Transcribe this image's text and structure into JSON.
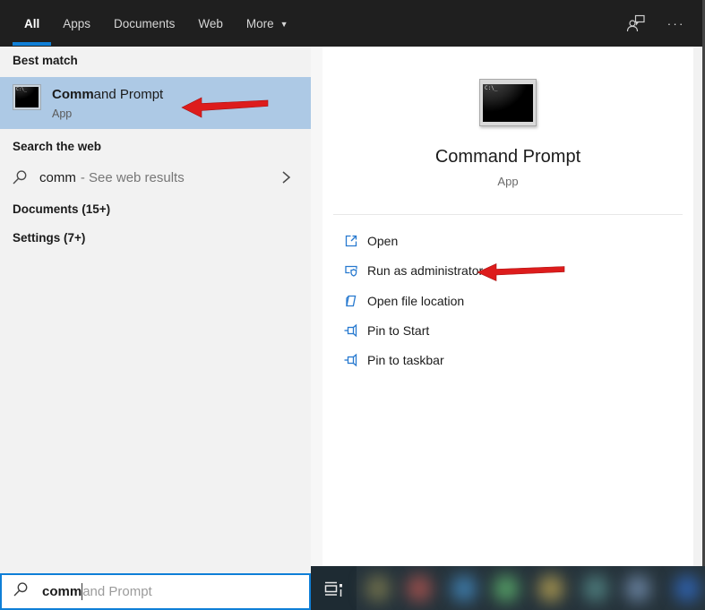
{
  "header": {
    "tabs": [
      {
        "label": "All",
        "active": true
      },
      {
        "label": "Apps",
        "active": false
      },
      {
        "label": "Documents",
        "active": false
      },
      {
        "label": "Web",
        "active": false
      },
      {
        "label": "More",
        "active": false,
        "dropdown": true
      }
    ],
    "feedback_icon": "user-feedback",
    "options_icon": "more-options"
  },
  "left_panel": {
    "best_match_label": "Best match",
    "best_match": {
      "title_bold": "Comm",
      "title_rest": "and Prompt",
      "subtitle": "App"
    },
    "search_web_label": "Search the web",
    "web_row": {
      "query": "comm",
      "suffix": "- See web results"
    },
    "documents_label": "Documents (15+)",
    "settings_label": "Settings (7+)"
  },
  "right_panel": {
    "app_name": "Command Prompt",
    "app_type": "App",
    "actions": [
      {
        "label": "Open",
        "icon": "open-icon"
      },
      {
        "label": "Run as administrator",
        "icon": "shield-icon"
      },
      {
        "label": "Open file location",
        "icon": "folder-location-icon"
      },
      {
        "label": "Pin to Start",
        "icon": "pin-icon"
      },
      {
        "label": "Pin to taskbar",
        "icon": "pin-icon"
      }
    ]
  },
  "search_bar": {
    "typed": "comm",
    "suggestion": "and Prompt"
  },
  "colors": {
    "accent_blue": "#0f7fd7",
    "highlight_blue": "#adc9e5",
    "action_icon_blue": "#2779cf",
    "arrow_red": "#dd1c1c",
    "header_bg": "#1f1f1f",
    "left_panel_bg": "#f2f2f2",
    "taskbar_bg": "#26333b"
  }
}
